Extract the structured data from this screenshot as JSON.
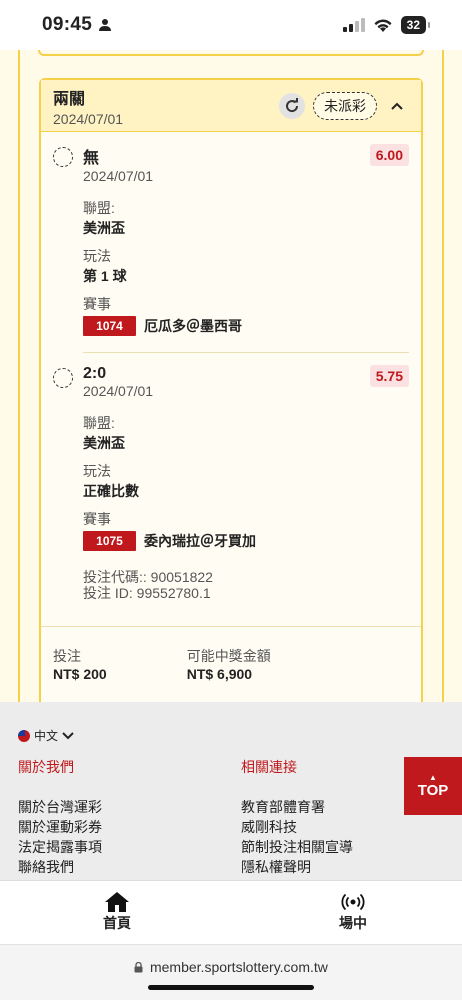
{
  "status_bar": {
    "time": "09:45",
    "battery": "32"
  },
  "card": {
    "title": "兩關",
    "date": "2024/07/01",
    "status": "未派彩",
    "bets": [
      {
        "selection": "無",
        "date": "2024/07/01",
        "odds": "6.00",
        "league_label": "聯盟:",
        "league": "美洲盃",
        "play_label": "玩法",
        "play": "第 1 球",
        "event_label": "賽事",
        "game_no": "1074",
        "game": "厄瓜多＠墨西哥"
      },
      {
        "selection": "2:0",
        "date": "2024/07/01",
        "odds": "5.75",
        "league_label": "聯盟:",
        "league": "美洲盃",
        "play_label": "玩法",
        "play": "正確比數",
        "event_label": "賽事",
        "game_no": "1075",
        "game": "委內瑞拉＠牙買加"
      }
    ],
    "bet_code": "投注代碼:: 90051822",
    "bet_id": "投注 ID: 99552780.1",
    "stake_label": "投注",
    "stake": "NT$ 200",
    "payout_label": "可能中獎金額",
    "payout": "NT$ 6,900"
  },
  "footer": {
    "language": "中文",
    "about_head": "關於我們",
    "about_items": [
      "關於台灣運彩",
      "關於運動彩券",
      "法定揭露事項",
      "聯絡我們"
    ],
    "links_head": "相關連接",
    "links_items": [
      "教育部體育署",
      "威剛科技",
      "節制投注相關宣導",
      "隱私權聲明"
    ],
    "top_label": "TOP"
  },
  "nav": {
    "home": "首頁",
    "live": "場中"
  },
  "url": "member.sportslottery.com.tw"
}
